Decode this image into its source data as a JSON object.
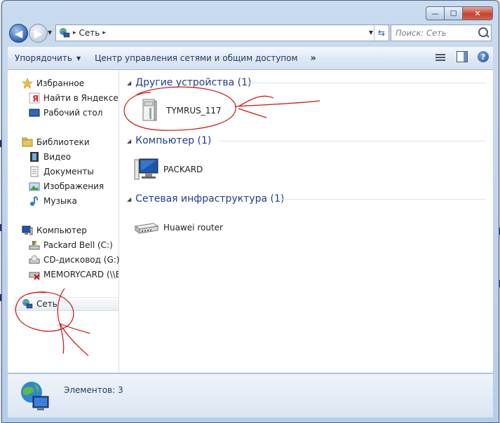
{
  "window": {
    "controls": {
      "minimize": "—",
      "maximize": "☐",
      "close": "✕"
    }
  },
  "nav": {
    "back_glyph": "◀",
    "forward_glyph": "▶",
    "address": {
      "location": "Сеть",
      "separator": "▸"
    },
    "search_placeholder": "Поиск: Сеть"
  },
  "toolbar": {
    "organize": "Упорядочить",
    "network_center": "Центр управления сетями и общим доступом",
    "more": "»",
    "help": "?"
  },
  "sidebar": {
    "favorites": {
      "label": "Избранное",
      "items": [
        "Найти в Яндексе",
        "Рабочий стол"
      ]
    },
    "libraries": {
      "label": "Библиотеки",
      "items": [
        "Видео",
        "Документы",
        "Изображения",
        "Музыка"
      ]
    },
    "computer": {
      "label": "Компьютер",
      "items": [
        "Packard Bell (C:)",
        "CD-дисковод (G:)",
        "MEMORYCARD (\\\\E"
      ]
    },
    "network": {
      "label": "Сеть"
    }
  },
  "groups": [
    {
      "header": "Другие устройства (1)",
      "devices": [
        "TYMRUS_117"
      ]
    },
    {
      "header": "Компьютер (1)",
      "devices": [
        "PACKARD"
      ]
    },
    {
      "header": "Сетевая инфраструктура (1)",
      "devices": [
        "Huawei router"
      ]
    }
  ],
  "status": {
    "count": "Элементов: 3"
  },
  "colors": {
    "accent": "#1e3d94",
    "annotation": "#d01010",
    "close": "#c7432d"
  }
}
